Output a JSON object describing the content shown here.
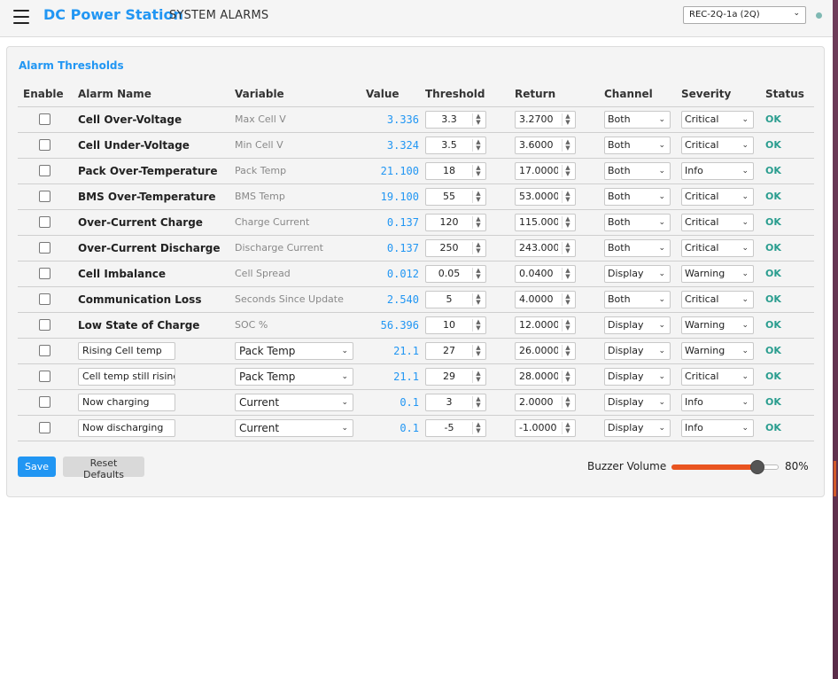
{
  "header": {
    "app_title": "DC Power Station",
    "page_title": "SYSTEM ALARMS",
    "device": "REC-2Q-1a (2Q)",
    "accent": "#2196f3"
  },
  "card": {
    "title": "Alarm Thresholds"
  },
  "columns": [
    "Enable",
    "Alarm Name",
    "Variable",
    "Value",
    "Threshold",
    "Return",
    "Channel",
    "Severity",
    "Status"
  ],
  "rows": [
    {
      "enabled": false,
      "name": "Cell Over-Voltage",
      "variable": "Max Cell V",
      "value": "3.336",
      "threshold": "3.3",
      "return": "3.2700",
      "channel": "Both",
      "severity": "Critical",
      "status": "OK"
    },
    {
      "enabled": false,
      "name": "Cell Under-Voltage",
      "variable": "Min Cell V",
      "value": "3.324",
      "threshold": "3.5",
      "return": "3.6000",
      "channel": "Both",
      "severity": "Critical",
      "status": "OK"
    },
    {
      "enabled": false,
      "name": "Pack Over-Temperature",
      "variable": "Pack Temp",
      "value": "21.100",
      "threshold": "18",
      "return": "17.0000",
      "channel": "Both",
      "severity": "Info",
      "status": "OK"
    },
    {
      "enabled": false,
      "name": "BMS Over-Temperature",
      "variable": "BMS Temp",
      "value": "19.100",
      "threshold": "55",
      "return": "53.0000",
      "channel": "Both",
      "severity": "Critical",
      "status": "OK"
    },
    {
      "enabled": false,
      "name": "Over-Current Charge",
      "variable": "Charge Current",
      "value": "0.137",
      "threshold": "120",
      "return": "115.000",
      "channel": "Both",
      "severity": "Critical",
      "status": "OK"
    },
    {
      "enabled": false,
      "name": "Over-Current Discharge",
      "variable": "Discharge Current",
      "value": "0.137",
      "threshold": "250",
      "return": "243.000",
      "channel": "Both",
      "severity": "Critical",
      "status": "OK"
    },
    {
      "enabled": false,
      "name": "Cell Imbalance",
      "variable": "Cell Spread",
      "value": "0.012",
      "threshold": "0.05",
      "return": "0.0400",
      "channel": "Display",
      "severity": "Warning",
      "status": "OK"
    },
    {
      "enabled": false,
      "name": "Communication Loss",
      "variable": "Seconds Since Update",
      "value": "2.540",
      "threshold": "5",
      "return": "4.0000",
      "channel": "Both",
      "severity": "Critical",
      "status": "OK"
    },
    {
      "enabled": false,
      "name": "Low State of Charge",
      "variable": "SOC %",
      "value": "56.396",
      "threshold": "10",
      "return": "12.0000",
      "channel": "Display",
      "severity": "Warning",
      "status": "OK"
    }
  ],
  "custom_rows": [
    {
      "enabled": false,
      "name": "Rising Cell temp",
      "variable": "Pack Temp",
      "value": "21.1",
      "threshold": "27",
      "return": "26.0000",
      "channel": "Display",
      "severity": "Warning",
      "status": "OK"
    },
    {
      "enabled": false,
      "name": "Cell temp still rising",
      "variable": "Pack Temp",
      "value": "21.1",
      "threshold": "29",
      "return": "28.0000",
      "channel": "Display",
      "severity": "Critical",
      "status": "OK"
    },
    {
      "enabled": false,
      "name": "Now charging",
      "variable": "Current",
      "value": "0.1",
      "threshold": "3",
      "return": "2.0000",
      "channel": "Display",
      "severity": "Info",
      "status": "OK"
    },
    {
      "enabled": false,
      "name": "Now discharging",
      "variable": "Current",
      "value": "0.1",
      "threshold": "-5",
      "return": "-1.0000",
      "channel": "Display",
      "severity": "Info",
      "status": "OK"
    }
  ],
  "buttons": {
    "save": "Save",
    "reset": "Reset Defaults"
  },
  "buzzer": {
    "label": "Buzzer Volume",
    "value": 80,
    "value_label": "80%",
    "fill_color": "#e95420"
  },
  "status_color": "#2a9d8f"
}
